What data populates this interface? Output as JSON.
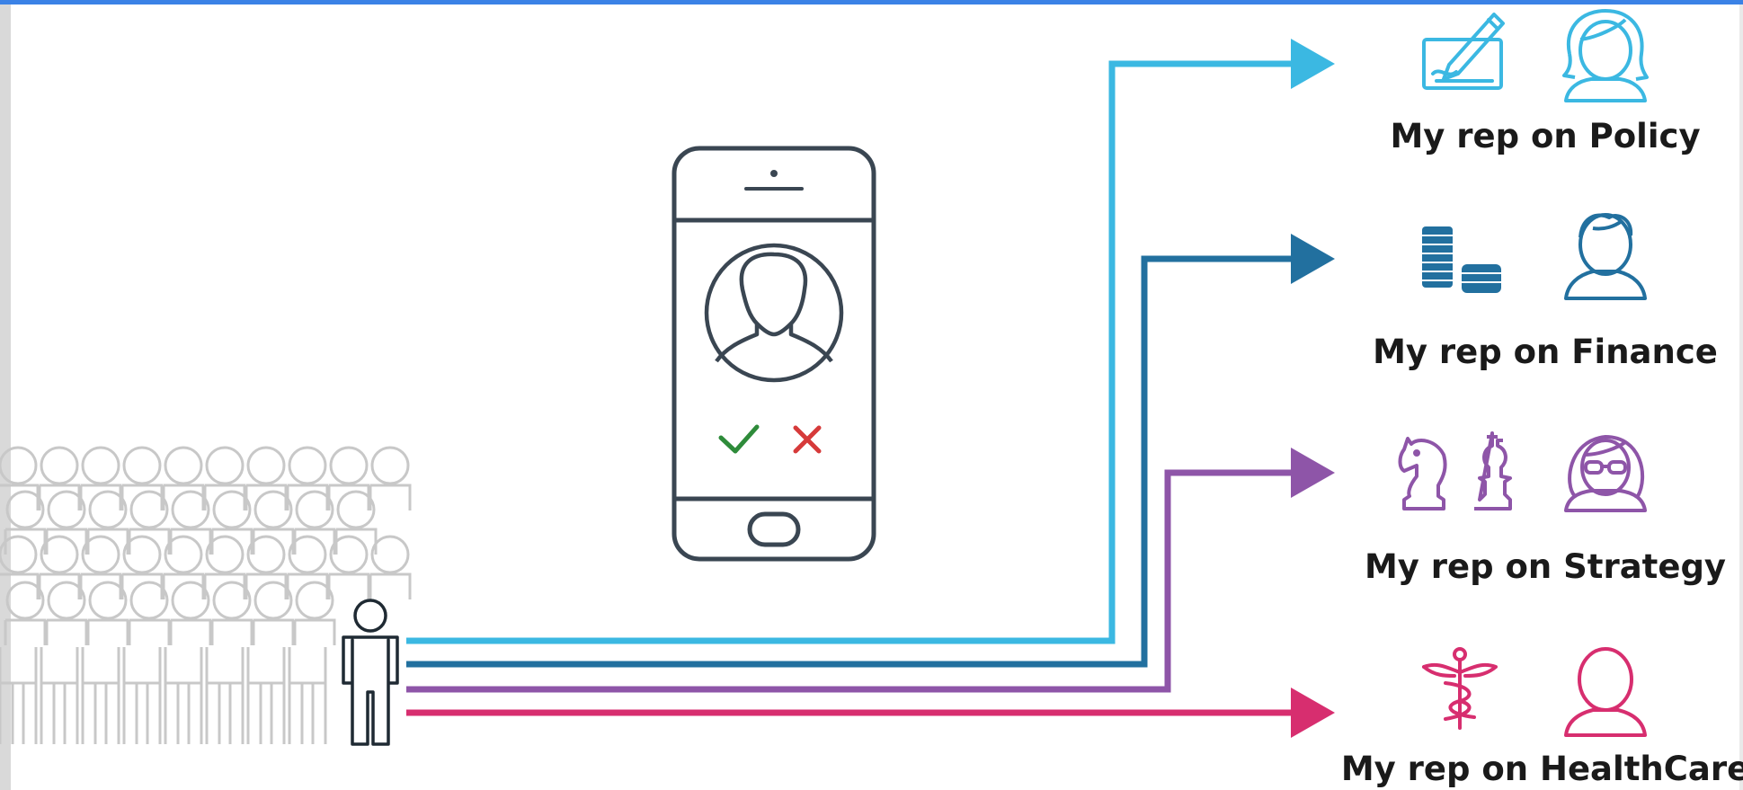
{
  "colors": {
    "policy": "#3bb8e2",
    "finance": "#22709f",
    "strategy": "#8e55a8",
    "healthcare": "#d72e6f",
    "crowd": "#c8c8c8",
    "outline": "#1f2a33",
    "check": "#2e8b3a",
    "cross": "#d63a3a",
    "phone": "#3a4652"
  },
  "icons": {
    "crowd": "crowd-icon",
    "person": "person-icon",
    "phone": "smartphone-icon",
    "policy": [
      "signing-pen-icon",
      "woman-avatar-icon"
    ],
    "finance": [
      "coin-stacks-icon",
      "man-avatar-icon"
    ],
    "strategy": [
      "chess-pieces-icon",
      "woman-glasses-avatar-icon"
    ],
    "healthcare": [
      "caduceus-icon",
      "bald-man-avatar-icon"
    ]
  },
  "reps": [
    {
      "label": "My rep on Policy"
    },
    {
      "label": "My rep on Finance"
    },
    {
      "label": "My rep on Strategy"
    },
    {
      "label": "My rep on HealthCare"
    }
  ]
}
